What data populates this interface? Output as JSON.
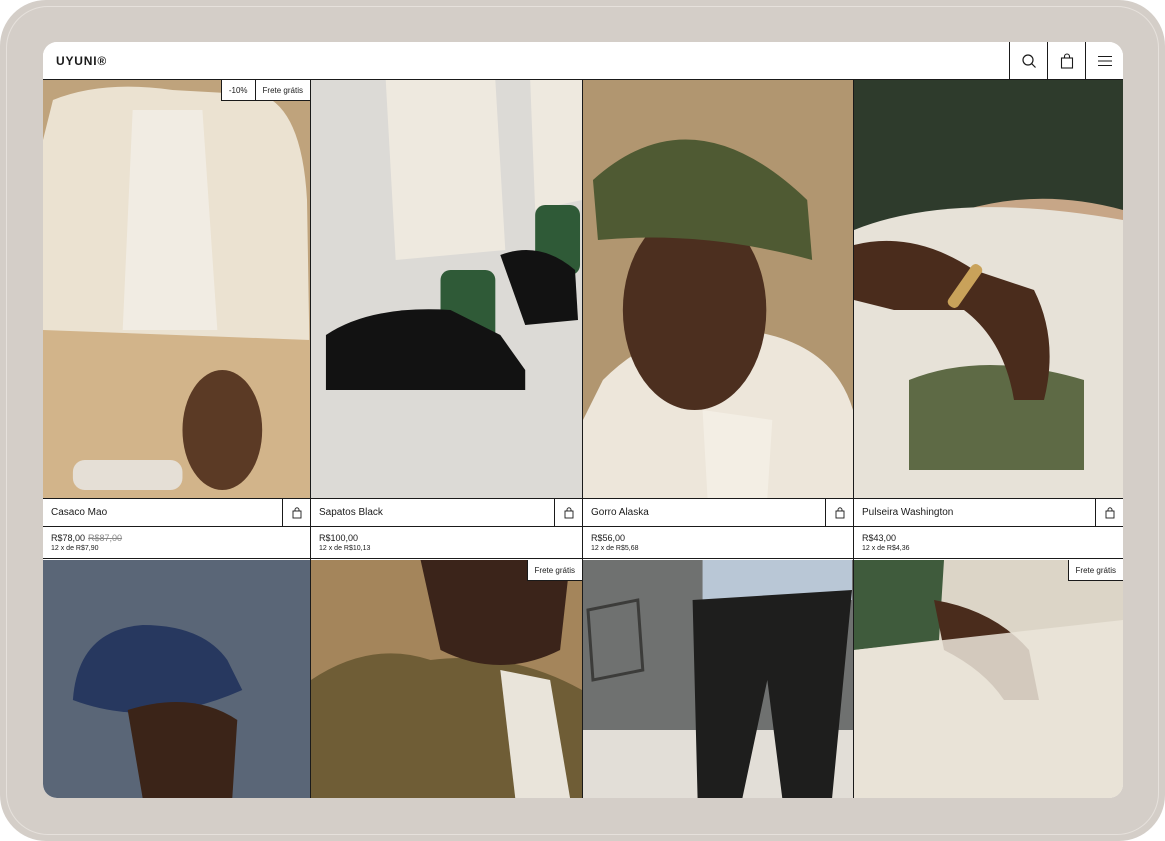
{
  "header": {
    "logo": "UYUNI®"
  },
  "products": [
    {
      "name": "Casaco Mao",
      "price": "R$78,00",
      "old_price": "R$87,00",
      "installments": "12 x de R$7,90",
      "badges": [
        "-10%",
        "Frete grátis"
      ]
    },
    {
      "name": "Sapatos Black",
      "price": "R$100,00",
      "old_price": "",
      "installments": "12 x de R$10,13",
      "badges": []
    },
    {
      "name": "Gorro Alaska",
      "price": "R$56,00",
      "old_price": "",
      "installments": "12 x de R$5,68",
      "badges": []
    },
    {
      "name": "Pulseira Washington",
      "price": "R$43,00",
      "old_price": "",
      "installments": "12 x de R$4,36",
      "badges": []
    }
  ],
  "row2": [
    {
      "badges": []
    },
    {
      "badges": [
        "Frete grátis"
      ]
    },
    {
      "badges": []
    },
    {
      "badges": [
        "Frete grátis"
      ]
    }
  ],
  "icons": {
    "search": "search-icon",
    "bag": "shopping-bag-icon",
    "menu": "menu-icon"
  }
}
